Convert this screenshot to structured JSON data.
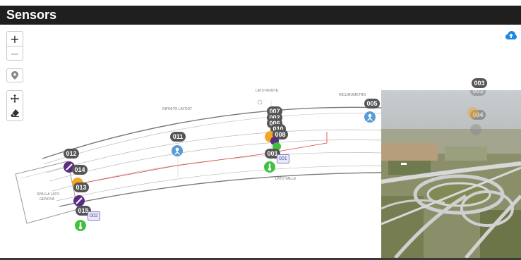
{
  "header": {
    "title": "Sensors"
  },
  "controls": {
    "zoom_in": "+",
    "zoom_out": "−"
  },
  "colors": {
    "header_bg": "#1f1f1f",
    "accent_blue": "#1e88e5",
    "label_bg": "#555555",
    "alarm_red": "#e53935"
  },
  "icons": [
    "plus-icon",
    "minus-icon",
    "map-pin-icon",
    "move-icon",
    "eraser-icon",
    "cloud-upload-icon"
  ],
  "plan": {
    "texts": {
      "lato_monte": "LATO MONTE",
      "lato_valle": "LATO VALLE",
      "spalla": "SPALLA LATO",
      "spalla2": "GENOVA",
      "inclino_a": "INFINITO LAYOUT",
      "inclino_b": "INCLINOMETRO"
    }
  },
  "sensors": {
    "s003": "003",
    "s005": "005",
    "s007": "007",
    "s002": "002",
    "s006": "006",
    "s010": "010",
    "s008": "008",
    "s011": "011",
    "s001": "001",
    "s012": "012",
    "s014": "014",
    "s013": "013",
    "s015": "015"
  },
  "tags": {
    "t_001": "001",
    "t_002": "002"
  },
  "photo_overlay": {
    "o003": "003",
    "o004": "004"
  }
}
